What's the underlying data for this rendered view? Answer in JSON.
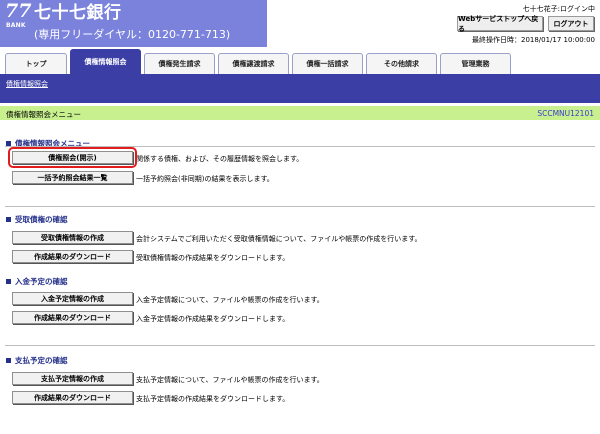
{
  "header": {
    "logo_number": "77",
    "logo_bank": "BANK",
    "bank_name": "七十七銀行",
    "phone": "(専用フリーダイヤル：0120-771-713)",
    "user_status": "七十七花子:ログイン中",
    "web_top_button": "Webサービストップへ戻る",
    "logout_button": "ログアウト",
    "last_operation": "最終操作日時：2018/01/17 10:00:00"
  },
  "tabs": [
    {
      "label": "トップ",
      "active": false
    },
    {
      "label": "債権情報照会",
      "active": true
    },
    {
      "label": "債権発生請求",
      "active": false
    },
    {
      "label": "債権譲渡請求",
      "active": false
    },
    {
      "label": "債権一括請求",
      "active": false
    },
    {
      "label": "その他請求",
      "active": false
    },
    {
      "label": "管理業務",
      "active": false
    }
  ],
  "sub_nav": {
    "link": "債権情報照会"
  },
  "page": {
    "title": "債権情報照会メニュー",
    "screen_id": "SCCMNU12101"
  },
  "sections": [
    {
      "heading": "債権情報照会メニュー",
      "rows": [
        {
          "button": "債権照会(開示)",
          "desc": "関係する債権、および、その履歴情報を照会します。"
        },
        {
          "button": "一括予約照会結果一覧",
          "desc": "一括予約照会(非同期)の結果を表示します。"
        }
      ]
    },
    {
      "heading": "受取債権の確認",
      "rows": [
        {
          "button": "受取債権情報の作成",
          "desc": "会計システムでご利用いただく受取債権情報について、ファイルや帳票の作成を行います。"
        },
        {
          "button": "作成結果のダウンロード",
          "desc": "受取債権情報の作成結果をダウンロードします。"
        }
      ]
    },
    {
      "heading": "入金予定の確認",
      "rows": [
        {
          "button": "入金予定情報の作成",
          "desc": "入金予定情報について、ファイルや帳票の作成を行います。"
        },
        {
          "button": "作成結果のダウンロード",
          "desc": "入金予定情報の作成結果をダウンロードします。"
        }
      ]
    },
    {
      "heading": "支払予定の確認",
      "rows": [
        {
          "button": "支払予定情報の作成",
          "desc": "支払予定情報について、ファイルや帳票の作成を行います。"
        },
        {
          "button": "作成結果のダウンロード",
          "desc": "支払予定情報の作成結果をダウンロードします。"
        }
      ]
    }
  ],
  "colors": {
    "nav_blue": "#3b3ea5",
    "title_green": "#c8f08e",
    "brand_purple": "#7b82dc",
    "highlight_red": "#e01c1c"
  }
}
